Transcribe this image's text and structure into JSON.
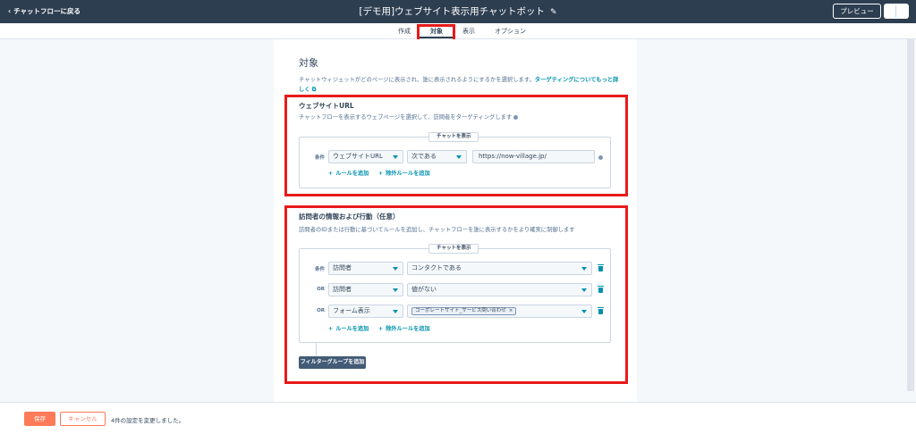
{
  "topbar": {
    "back_label": "チャットフローに戻る",
    "title": "[デモ用]ウェブサイト表示用チャットボット",
    "preview_label": "プレビュー"
  },
  "tabs": [
    "作成",
    "対象",
    "表示",
    "オプション"
  ],
  "page": {
    "heading": "対象",
    "description": "チャットウィジェットがどのページに表示され、誰に表示されるようにするかを選択します。",
    "link": "ターゲティングについてもっと詳しく"
  },
  "website_section": {
    "title": "ウェブサイトURL",
    "desc": "チャットフローを表示するウェブページを選択して、訪問者をターゲティングします",
    "chip": "チャットを表示",
    "row_label": "条件",
    "field": "ウェブサイトURL",
    "operator": "次である",
    "value": "https://now-village.jp/",
    "add_rule": "ルールを追加",
    "add_exclusion": "除外ルールを追加"
  },
  "visitor_section": {
    "title": "訪問者の情報および行動（任意）",
    "desc": "訪問者のIDまたは行動に基づいてルールを追加し、チャットフローを誰に表示するかをより確実に制御します",
    "chip": "チャットを表示",
    "rows": [
      {
        "label": "条件",
        "field": "訪問者",
        "value": "コンタクトである"
      },
      {
        "label": "OR",
        "field": "訪問者",
        "value": "値がない"
      },
      {
        "label": "OR",
        "field": "フォーム表示",
        "tag": "コーポレートサイト_サービス問い合わせ"
      }
    ],
    "add_rule": "ルールを追加",
    "add_exclusion": "除外ルールを追加",
    "filter_group_button": "フィルターグループを追加"
  },
  "footer": {
    "save": "保存",
    "cancel": "キャンセル",
    "message": "4件の設定を変更しました。"
  },
  "colors": {
    "topbar": "#2d3e50",
    "accent": "#0091ae",
    "primary_button": "#ff7a59",
    "highlight": "#e81a1a"
  }
}
